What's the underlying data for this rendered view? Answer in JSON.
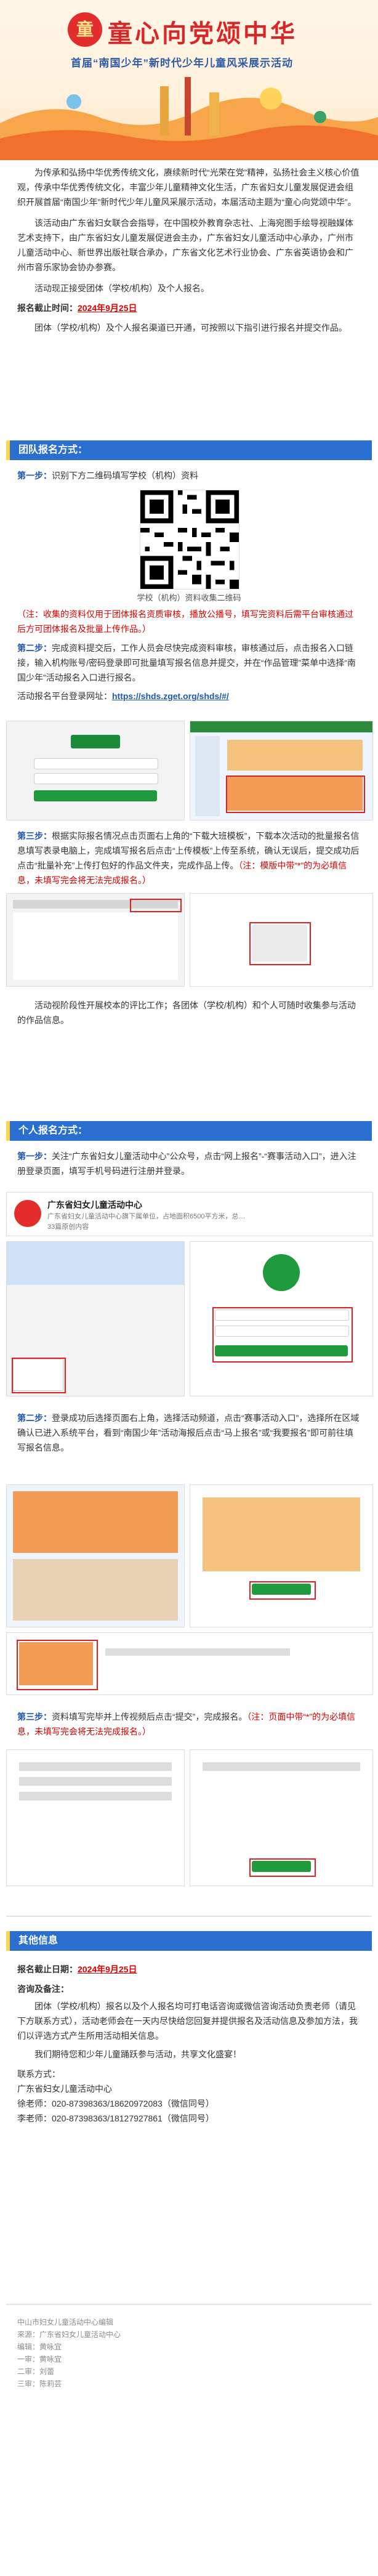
{
  "banner": {
    "title": "童心向党颂中华",
    "subtitle": "首届“南国少年”新时代少年儿童风采展示活动",
    "emblem": "童"
  },
  "intro": {
    "p1": "为传承和弘扬中华优秀传统文化，赓续新时代“光荣在党”精神，弘扬社会主义核心价值观，传承中华优秀传统文化，丰富少年儿童精神文化生活，广东省妇女儿童发展促进会组织开展首届“南国少年”新时代少年儿童风采展示活动，本届活动主题为“童心向党颂中华”。",
    "p2": "该活动由广东省妇女联合会指导，在中国校外教育杂志社、上海宛图手绘导视融媒体艺术支持下，由广东省妇女儿童发展促进会主办，广东省妇女儿童活动中心承办，广州市儿童活动中心、新世界出版社联合承办，广东省文化艺术行业协会、广东省英语协会和广州市音乐家协会协办参赛。",
    "p3": "活动现正接受团体（学校/机构）及个人报名。",
    "deadline_label": "报名截止时间：",
    "deadline_value": "2024年9月25日",
    "p4": "团体（学校/机构）及个人报名渠道已开通，可按照以下指引进行报名并提交作品。"
  },
  "group": {
    "header": "团队报名方式：",
    "step1_label": "第一步：",
    "step1_text": "识别下方二维码填写学校（机构）资料",
    "qr_caption": "学校（机构）资料收集二维码",
    "note1": "（注：收集的资料仅用于团体报名资质审核，播放公播号，填写完资料后需平台审核通过后方可团体报名及批量上传作品。）",
    "step2_label": "第二步：",
    "step2_text": "完成资料提交后，工作人员会尽快完成资料审核，审核通过后，点击报名入口链接，输入机构账号/密码登录即可批量填写报名信息并提交，并在“作品管理”菜单中选择“南国少年”活动报名入口进行报名。",
    "platform_label": "活动报名平台登录网址：",
    "platform_url": "https://shds.zget.org/shds/#/",
    "step3_label": "第三步：",
    "step3_text": "根据实际报名情况点击页面右上角的“下载大班模板”，下载本次活动的批量报名信息填写表录电脑上，完成填写报名后点击“上传模板”上传至系统，确认无误后，提交成功后点击“批量补充”上传打包好的作品文件夹，完成作品上传。",
    "note3": "（注：模版中带“*”的为必填信息，未填写完会将无法完成报名。）",
    "tail": "活动视阶段性开展校本的评比工作；各团体（学校/机构）和个人可随时收集参与活动的作品信息。"
  },
  "personal": {
    "header": "个人报名方式：",
    "step1_label": "第一步：",
    "step1_text": "关注“广东省妇女儿童活动中心”公众号，点击“网上报名”-“赛事活动入口”，进入注册登录页面，填写手机号码进行注册并登录。",
    "wechat_name": "广东省妇女儿童活动中心",
    "wechat_desc": "广东省妇女儿童活动中心旗下属单位，占地面积6500平方米，总…",
    "wechat_followers": "33篇原创内容",
    "step2_label": "第二步：",
    "step2_text": "登录成功后选择页面右上角，选择活动频道，点击“赛事活动入口”，选择所在区域确认已进入系统平台，看到“南国少年”活动海报后点击“马上报名”或“我要报名”即可前往填写报名信息。",
    "step3_label": "第三步：",
    "step3_text": "资料填写完毕并上传视频后点击“提交”，完成报名。",
    "note3": "（注：页面中带“*”的为必填信息，未填写完会将无法完成报名。）"
  },
  "other": {
    "header": "其他信息",
    "deadline_label": "报名截止日期：",
    "deadline_value": "2024年9月25日",
    "notes_title": "咨询及备注：",
    "notes_text": "团体（学校/机构）报名以及个人报名均可打电话咨询或微信咨询活动负责老师（请见下方联系方式），活动老师会在一天内尽快给您回复并提供报名及活动信息及参加方法，我们以评选方式产生所用活动相关信息。",
    "closing": "我们期待您和少年儿童踊跃参与活动，共享文化盛宴！",
    "contact_label": "联系方式：",
    "contact_org": "广东省妇女儿童活动中心",
    "phone1": "徐老师：020-87398363/18620972083（微信同号）",
    "phone2": "李老师：020-87398363/18127927861（微信同号）"
  },
  "footer": {
    "line1": "中山市妇女儿童活动中心编辑",
    "line2": "来源：广东省妇女儿童活动中心",
    "line3": "编辑：黄咏宜",
    "line4": "一审：黄咏宜",
    "line5": "二审：刘蕾",
    "line6": "三审：陈莉芸"
  },
  "colors": {
    "accent_blue": "#2a6ecf",
    "accent_red": "#d90000",
    "header_left": "#ffd54a"
  }
}
